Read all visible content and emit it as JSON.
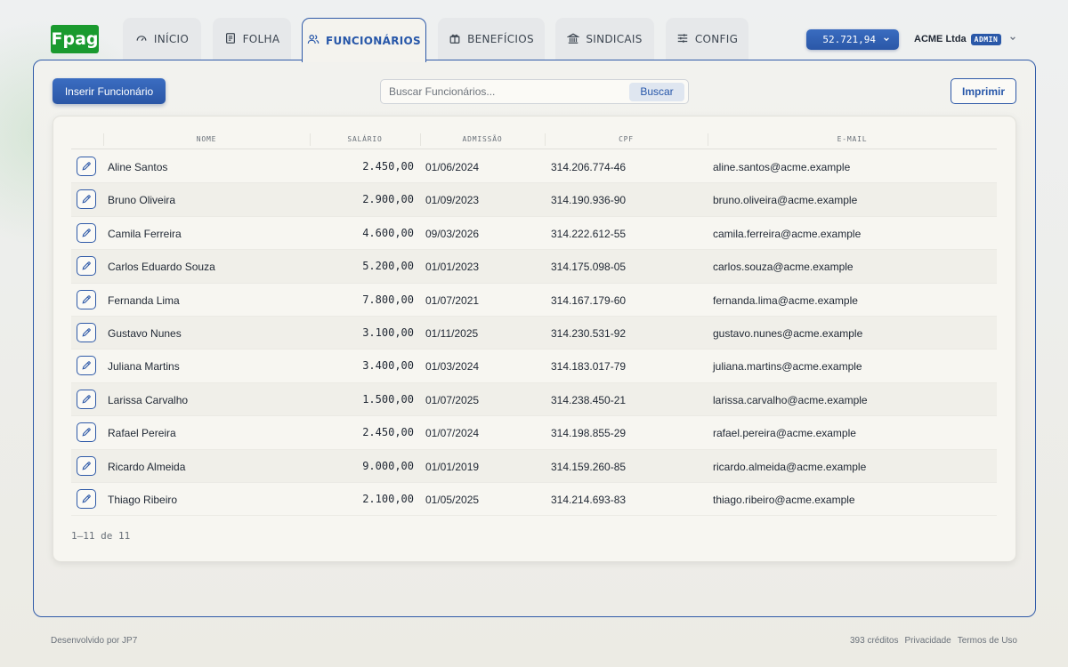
{
  "brand": {
    "logo_text": "Fpag",
    "logo_color": "#1a9a2e"
  },
  "tabs": [
    {
      "label": "INÍCIO",
      "icon": "gauge-icon",
      "active": false
    },
    {
      "label": "FOLHA",
      "icon": "document-icon",
      "active": false
    },
    {
      "label": "FUNCIONÁRIOS",
      "icon": "users-icon",
      "active": true
    },
    {
      "label": "BENEFÍCIOS",
      "icon": "gift-icon",
      "active": false
    },
    {
      "label": "SINDICAIS",
      "icon": "bank-icon",
      "active": false
    },
    {
      "label": "CONFIG",
      "icon": "sliders-icon",
      "active": false
    }
  ],
  "header": {
    "balance": "52.721,94",
    "company": "ACME Ltda",
    "role_badge": "ADMIN"
  },
  "toolbar": {
    "insert_label": "Inserir Funcionário",
    "search_placeholder": "Buscar Funcionários...",
    "search_button": "Buscar",
    "print_label": "Imprimir"
  },
  "table": {
    "columns": [
      "NOME",
      "SALÁRIO",
      "ADMISSÃO",
      "CPF",
      "E-MAIL"
    ],
    "rows": [
      {
        "name": "Aline Santos",
        "salary": "2.450,00",
        "admission": "01/06/2024",
        "cpf": "314.206.774-46",
        "email": "aline.santos@acme.example"
      },
      {
        "name": "Bruno Oliveira",
        "salary": "2.900,00",
        "admission": "01/09/2023",
        "cpf": "314.190.936-90",
        "email": "bruno.oliveira@acme.example"
      },
      {
        "name": "Camila Ferreira",
        "salary": "4.600,00",
        "admission": "09/03/2026",
        "cpf": "314.222.612-55",
        "email": "camila.ferreira@acme.example"
      },
      {
        "name": "Carlos Eduardo Souza",
        "salary": "5.200,00",
        "admission": "01/01/2023",
        "cpf": "314.175.098-05",
        "email": "carlos.souza@acme.example"
      },
      {
        "name": "Fernanda Lima",
        "salary": "7.800,00",
        "admission": "01/07/2021",
        "cpf": "314.167.179-60",
        "email": "fernanda.lima@acme.example"
      },
      {
        "name": "Gustavo Nunes",
        "salary": "3.100,00",
        "admission": "01/11/2025",
        "cpf": "314.230.531-92",
        "email": "gustavo.nunes@acme.example"
      },
      {
        "name": "Juliana Martins",
        "salary": "3.400,00",
        "admission": "01/03/2024",
        "cpf": "314.183.017-79",
        "email": "juliana.martins@acme.example"
      },
      {
        "name": "Larissa Carvalho",
        "salary": "1.500,00",
        "admission": "01/07/2025",
        "cpf": "314.238.450-21",
        "email": "larissa.carvalho@acme.example"
      },
      {
        "name": "Rafael Pereira",
        "salary": "2.450,00",
        "admission": "01/07/2024",
        "cpf": "314.198.855-29",
        "email": "rafael.pereira@acme.example"
      },
      {
        "name": "Ricardo Almeida",
        "salary": "9.000,00",
        "admission": "01/01/2019",
        "cpf": "314.159.260-85",
        "email": "ricardo.almeida@acme.example"
      },
      {
        "name": "Thiago Ribeiro",
        "salary": "2.100,00",
        "admission": "01/05/2025",
        "cpf": "314.214.693-83",
        "email": "thiago.ribeiro@acme.example"
      }
    ],
    "pagination": "1–11 de 11"
  },
  "footer": {
    "credit": "Desenvolvido por JP7",
    "credits_count": "393 créditos",
    "privacy": "Privacidade",
    "terms": "Termos de Uso"
  },
  "colors": {
    "accent": "#2f5aa8",
    "brand": "#1a9a2e"
  }
}
